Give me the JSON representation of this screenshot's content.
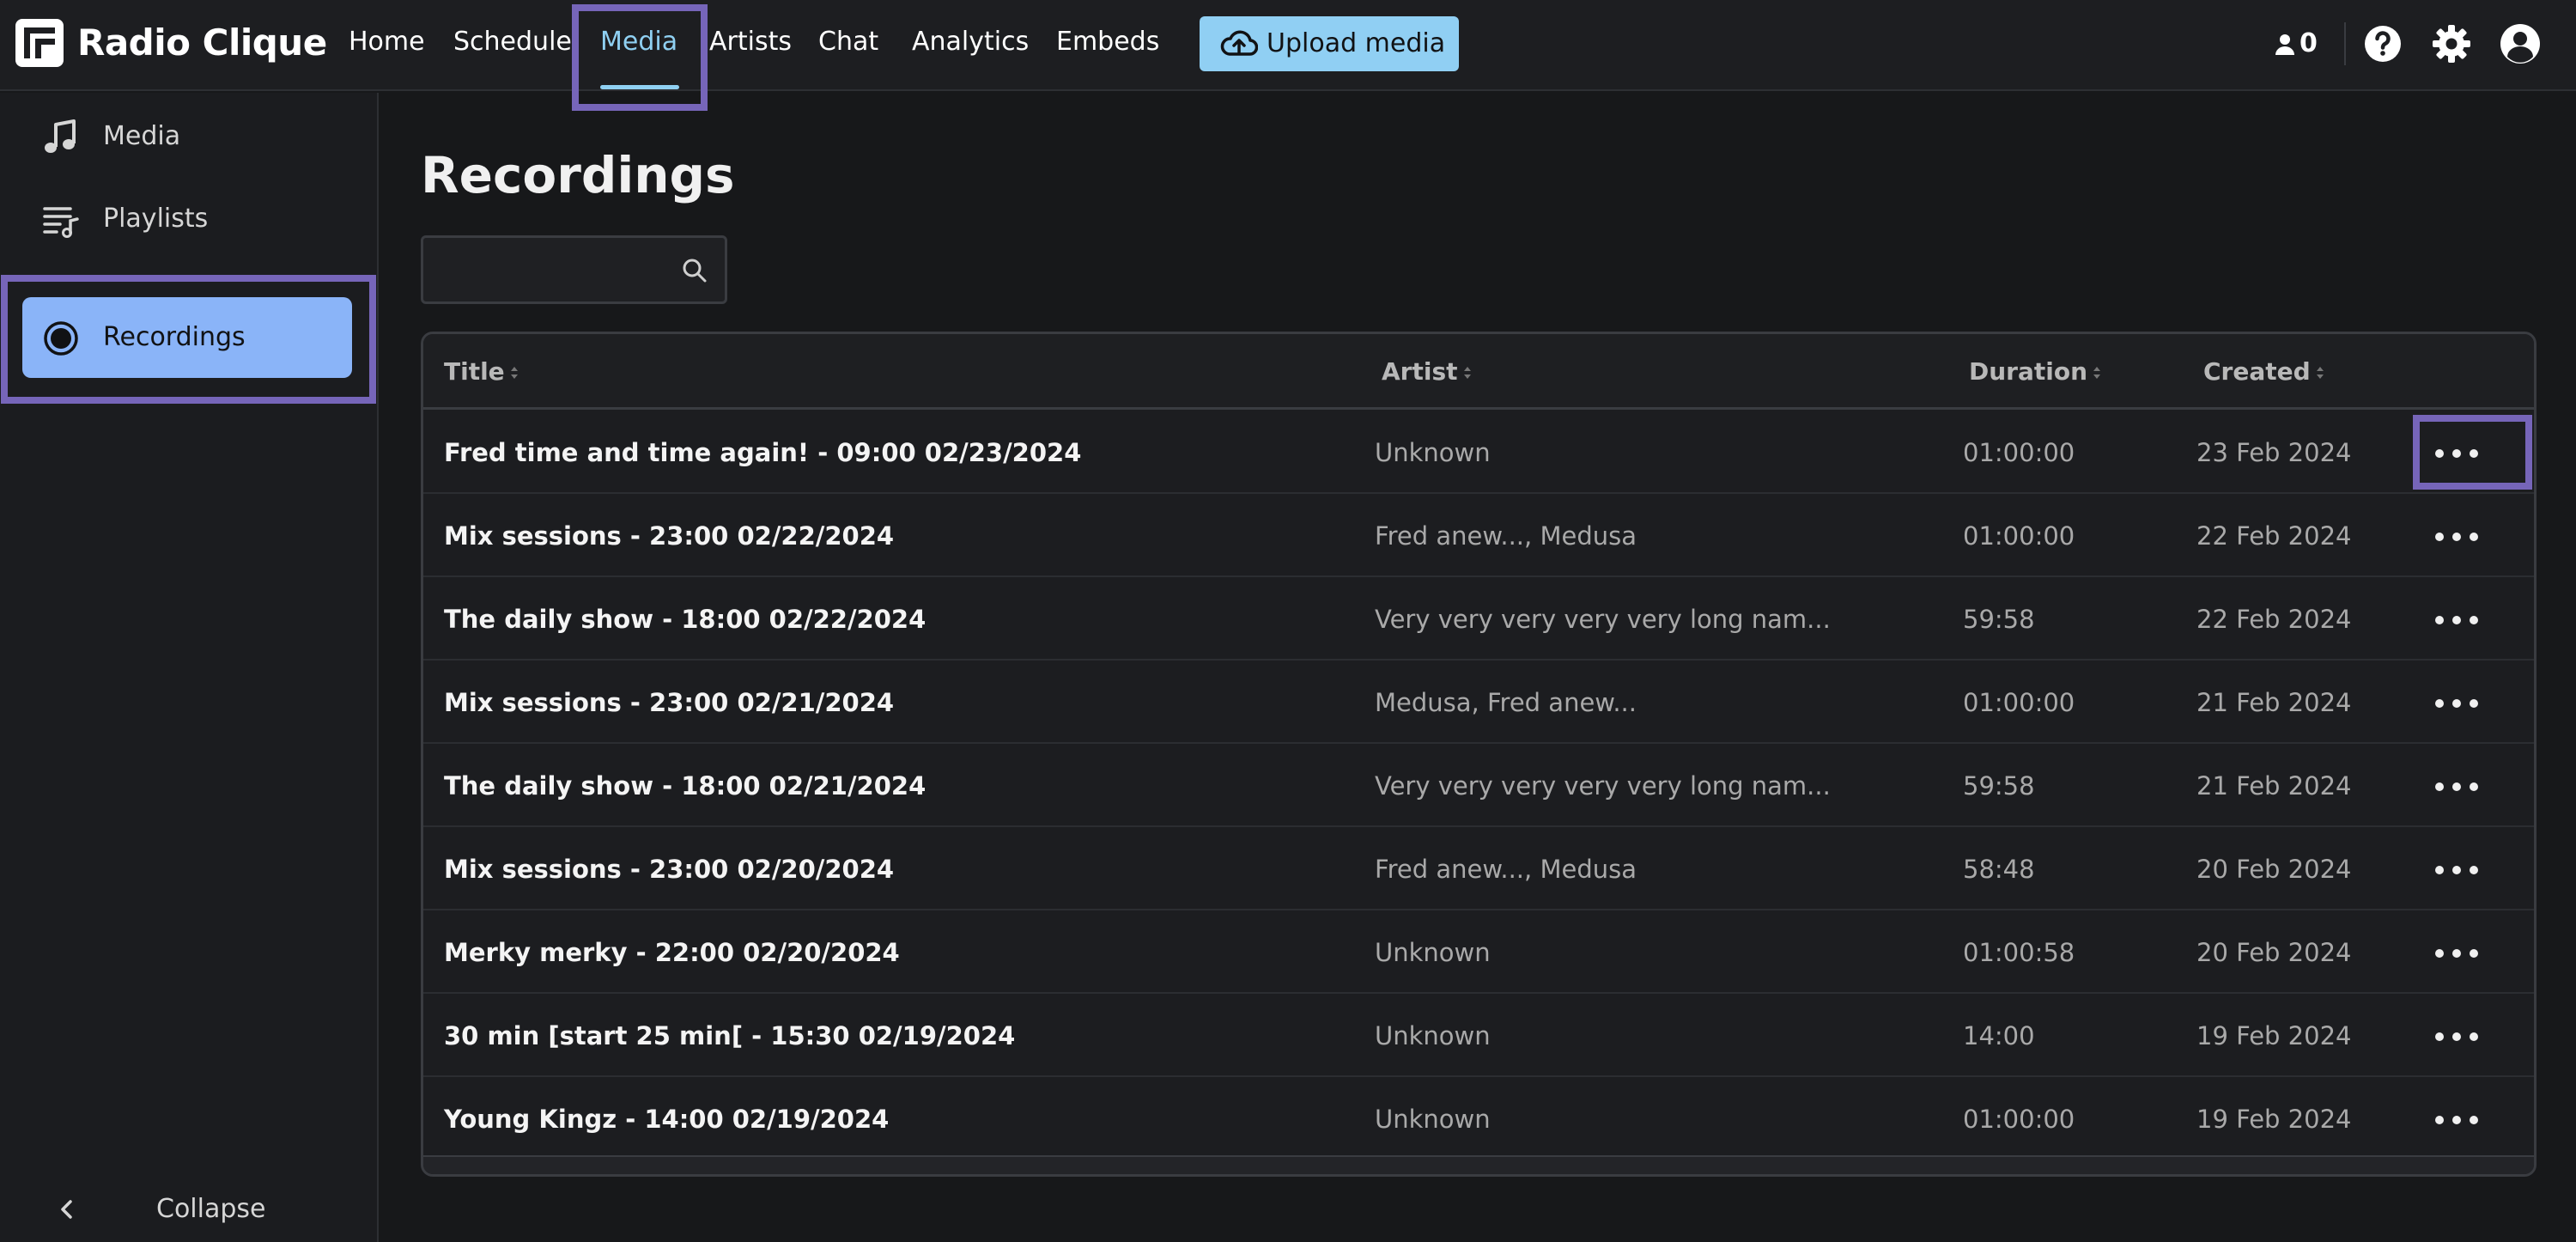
{
  "app": {
    "brand": "Radio Clique"
  },
  "nav": {
    "items": [
      {
        "label": "Home"
      },
      {
        "label": "Schedule"
      },
      {
        "label": "Media"
      },
      {
        "label": "Artists"
      },
      {
        "label": "Chat"
      },
      {
        "label": "Analytics"
      },
      {
        "label": "Embeds"
      }
    ],
    "active": "Media",
    "upload_label": "Upload media",
    "listener_count": "0"
  },
  "sidebar": {
    "items": [
      {
        "label": "Media",
        "icon": "music-note-icon"
      },
      {
        "label": "Playlists",
        "icon": "playlist-icon"
      },
      {
        "label": "Recordings",
        "icon": "record-icon"
      }
    ],
    "active": "Recordings",
    "collapse_label": "Collapse"
  },
  "main": {
    "title": "Recordings",
    "search": {
      "value": "",
      "placeholder": ""
    },
    "columns": [
      "Title",
      "Artist",
      "Duration",
      "Created"
    ],
    "rows": [
      {
        "title": "Fred time and time again! - 09:00 02/23/2024",
        "artist": "Unknown",
        "duration": "01:00:00",
        "created": "23 Feb 2024"
      },
      {
        "title": "Mix sessions - 23:00 02/22/2024",
        "artist": "Fred anew..., Medusa",
        "duration": "01:00:00",
        "created": "22 Feb 2024"
      },
      {
        "title": "The daily show - 18:00 02/22/2024",
        "artist": "Very very very very very long nam...",
        "duration": "59:58",
        "created": "22 Feb 2024"
      },
      {
        "title": "Mix sessions - 23:00 02/21/2024",
        "artist": "Medusa, Fred anew...",
        "duration": "01:00:00",
        "created": "21 Feb 2024"
      },
      {
        "title": "The daily show - 18:00 02/21/2024",
        "artist": "Very very very very very long nam...",
        "duration": "59:58",
        "created": "21 Feb 2024"
      },
      {
        "title": "Mix sessions - 23:00 02/20/2024",
        "artist": "Fred anew..., Medusa",
        "duration": "58:48",
        "created": "20 Feb 2024"
      },
      {
        "title": "Merky merky - 22:00 02/20/2024",
        "artist": "Unknown",
        "duration": "01:00:58",
        "created": "20 Feb 2024"
      },
      {
        "title": "30 min [start 25 min[ - 15:30 02/19/2024",
        "artist": "Unknown",
        "duration": "14:00",
        "created": "19 Feb 2024"
      },
      {
        "title": "Young Kingz - 14:00 02/19/2024",
        "artist": "Unknown",
        "duration": "01:00:00",
        "created": "19 Feb 2024"
      }
    ]
  },
  "colors": {
    "accent": "#8fd0f2",
    "sidebar_active": "#8ab4f8",
    "highlight": "#7665b9",
    "background": "#17181a"
  }
}
